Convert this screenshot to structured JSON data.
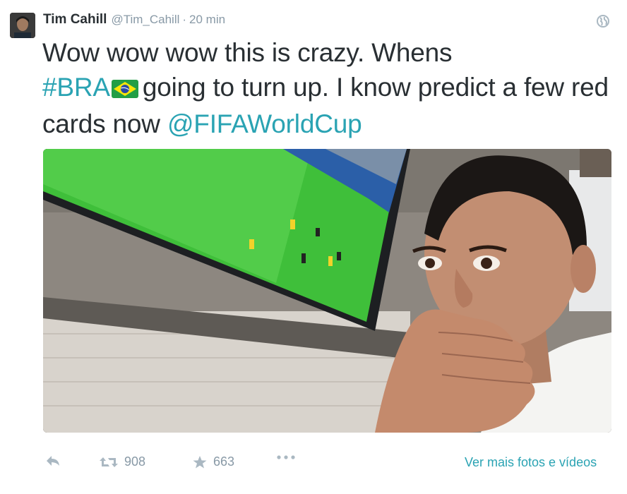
{
  "tweet": {
    "author_name": "Tim Cahill",
    "author_handle": "@Tim_Cahill",
    "separator": "·",
    "time": "20 min",
    "text_part1": "Wow wow wow this is crazy. Whens",
    "hashtag": "#BRA",
    "text_part2": "going to turn up. I know predict a few red cards now",
    "mention": "@FIFAWorldCup"
  },
  "icons": {
    "globe": "globe-icon",
    "flag": "brazil-flag-icon",
    "reply": "reply-icon",
    "retweet": "retweet-icon",
    "favorite": "star-icon",
    "more": "more-icon"
  },
  "actions": {
    "retweet_count": "908",
    "favorite_count": "663",
    "view_more_label": "Ver mais fotos e vídeos"
  },
  "colors": {
    "link": "#2aa3b3",
    "text": "#292f33",
    "muted": "#8899a6"
  }
}
